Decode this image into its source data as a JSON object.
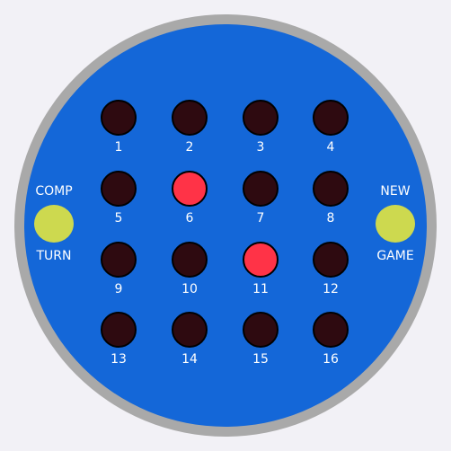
{
  "colors": {
    "background": "#f2f1f6",
    "rim": "#a9a9a9",
    "board": "#1467d8",
    "peg_off": "#2e0a10",
    "peg_on": "#ff3347",
    "button": "#cdd94f",
    "text": "#ffffff"
  },
  "left_control": {
    "label_top": "COMP",
    "label_bottom": "TURN"
  },
  "right_control": {
    "label_top": "NEW",
    "label_bottom": "GAME"
  },
  "cells": [
    {
      "label": "1",
      "lit": false
    },
    {
      "label": "2",
      "lit": false
    },
    {
      "label": "3",
      "lit": false
    },
    {
      "label": "4",
      "lit": false
    },
    {
      "label": "5",
      "lit": false
    },
    {
      "label": "6",
      "lit": true
    },
    {
      "label": "7",
      "lit": false
    },
    {
      "label": "8",
      "lit": false
    },
    {
      "label": "9",
      "lit": false
    },
    {
      "label": "10",
      "lit": false
    },
    {
      "label": "11",
      "lit": true
    },
    {
      "label": "12",
      "lit": false
    },
    {
      "label": "13",
      "lit": false
    },
    {
      "label": "14",
      "lit": false
    },
    {
      "label": "15",
      "lit": false
    },
    {
      "label": "16",
      "lit": false
    }
  ]
}
